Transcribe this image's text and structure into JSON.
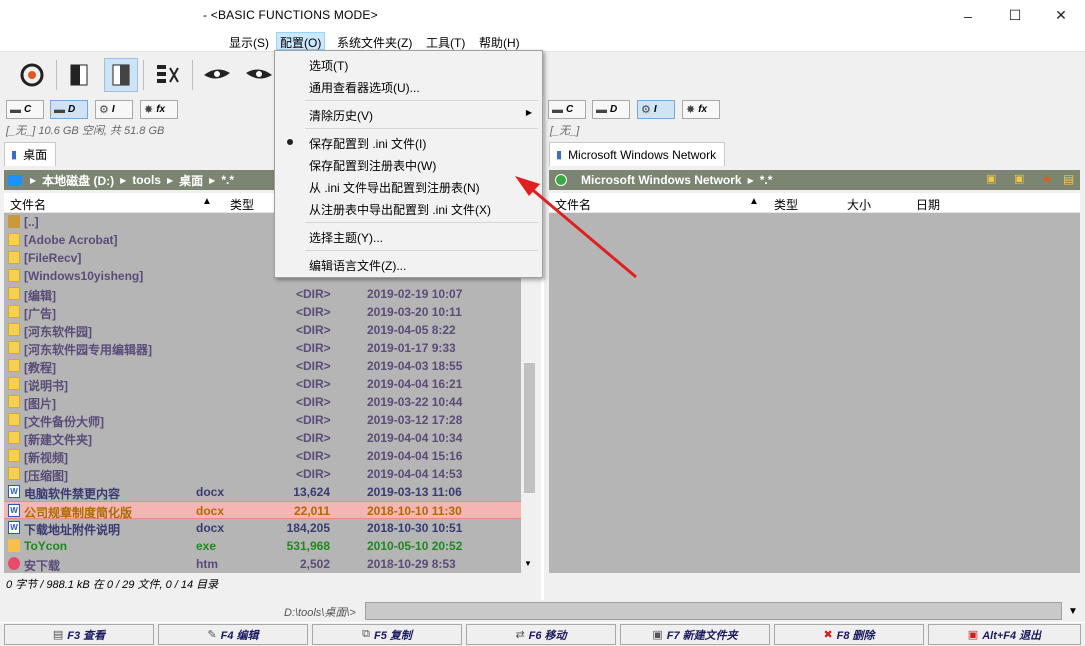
{
  "window": {
    "title": "- <BASIC FUNCTIONS MODE>",
    "minimize": "–",
    "maximize": "☐",
    "close": "✕"
  },
  "menu": [
    {
      "label": "显示(S)"
    },
    {
      "label": "配置(O)"
    },
    {
      "label": "系统文件夹(Z)"
    },
    {
      "label": "工具(T)"
    },
    {
      "label": "帮助(H)"
    }
  ],
  "popup": {
    "items": [
      "选项(T)",
      "通用查看器选项(U)...",
      "清除历史(V)",
      "保存配置到 .ini 文件(I)",
      "保存配置到注册表中(W)",
      "从 .ini 文件导出配置到注册表(N)",
      "从注册表中导出配置到 .ini 文件(X)",
      "选择主题(Y)...",
      "编辑语言文件(Z)..."
    ],
    "submenu_arrow": "▶"
  },
  "left": {
    "drives": [
      "C",
      "D",
      "I",
      "fx"
    ],
    "free": "[_无_] 10.6 GB 空闲, 共 51.8 GB",
    "tab": "桌面",
    "path": [
      "本地磁盘 (D:)",
      "tools",
      "桌面",
      "*.*"
    ],
    "cols": {
      "name": "文件名",
      "type": "类型"
    },
    "rows": [
      {
        "name": "[..]",
        "type": "",
        "size": "",
        "date": ""
      },
      {
        "name": "[Adobe Acrobat]",
        "type": "",
        "size": "",
        "date": ""
      },
      {
        "name": "[FileRecv]",
        "type": "",
        "size": "",
        "date": ""
      },
      {
        "name": "[Windows10yisheng]",
        "type": "",
        "size": "",
        "date": ""
      },
      {
        "name": "[编辑]",
        "type": "",
        "size": "<DIR>",
        "date": "2019-02-19 10:07"
      },
      {
        "name": "[广告]",
        "type": "",
        "size": "<DIR>",
        "date": "2019-03-20 10:11"
      },
      {
        "name": "[河东软件园]",
        "type": "",
        "size": "<DIR>",
        "date": "2019-04-05 8:22"
      },
      {
        "name": "[河东软件园专用编辑器]",
        "type": "",
        "size": "<DIR>",
        "date": "2019-01-17 9:33"
      },
      {
        "name": "[教程]",
        "type": "",
        "size": "<DIR>",
        "date": "2019-04-03 18:55"
      },
      {
        "name": "[说明书]",
        "type": "",
        "size": "<DIR>",
        "date": "2019-04-04 16:21"
      },
      {
        "name": "[图片]",
        "type": "",
        "size": "<DIR>",
        "date": "2019-03-22 10:44"
      },
      {
        "name": "[文件备份大师]",
        "type": "",
        "size": "<DIR>",
        "date": "2019-03-12 17:28"
      },
      {
        "name": "[新建文件夹]",
        "type": "",
        "size": "<DIR>",
        "date": "2019-04-04 10:34"
      },
      {
        "name": "[新视频]",
        "type": "",
        "size": "<DIR>",
        "date": "2019-04-04 15:16"
      },
      {
        "name": "[压缩图]",
        "type": "",
        "size": "<DIR>",
        "date": "2019-04-04 14:53"
      },
      {
        "name": "电脑软件禁更内容",
        "type": "docx",
        "size": "13,624",
        "date": "2019-03-13 11:06"
      },
      {
        "name": "公司规章制度简化版",
        "type": "docx",
        "size": "22,011",
        "date": "2018-10-10 11:30"
      },
      {
        "name": "下载地址附件说明",
        "type": "docx",
        "size": "184,205",
        "date": "2018-10-30 10:51"
      },
      {
        "name": "ToYcon",
        "type": "exe",
        "size": "531,968",
        "date": "2010-05-10 20:52"
      },
      {
        "name": "安下载",
        "type": "htm",
        "size": "2,502",
        "date": "2018-10-29 8:53"
      }
    ],
    "status": "0 字节 / 988.1 kB 在 0 / 29 文件, 0 / 14 目录"
  },
  "right": {
    "drives": [
      "C",
      "D",
      "I",
      "fx"
    ],
    "free": "[_无_]",
    "tab": "Microsoft Windows Network",
    "path": [
      "Microsoft Windows Network",
      "*.*"
    ],
    "cols": {
      "name": "文件名",
      "type": "类型",
      "size": "大小",
      "date": "日期"
    }
  },
  "cmd": {
    "prompt": "D:\\tools\\桌面\\>"
  },
  "fkeys": [
    "F3 查看",
    "F4 编辑",
    "F5 复制",
    "F6 移动",
    "F7 新建文件夹",
    "F8 删除",
    "Alt+F4 退出"
  ],
  "colors": {
    "selection": "#cce8ff",
    "pathbar": "#7b8571",
    "filelist": "#b5b5b5",
    "arrow": "#e02020"
  }
}
